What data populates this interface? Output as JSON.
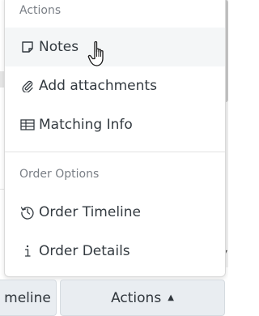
{
  "menu": {
    "section_actions": "Actions",
    "items_actions": [
      {
        "label": "Notes",
        "icon": "note-icon"
      },
      {
        "label": "Add attachments",
        "icon": "paperclip-icon"
      },
      {
        "label": "Matching Info",
        "icon": "table-icon"
      }
    ],
    "section_order": "Order Options",
    "items_order": [
      {
        "label": "Order Timeline",
        "icon": "history-icon"
      },
      {
        "label": "Order Details",
        "icon": "info-icon"
      }
    ],
    "hovered_item": "Notes"
  },
  "buttons": {
    "timeline_label": "meline",
    "actions_label": "Actions",
    "actions_caret": "▲"
  },
  "colors": {
    "text": "#333a40",
    "header": "#7a7f86",
    "hover_bg": "#f4f6f7",
    "button_bg": "#e9edf1"
  }
}
